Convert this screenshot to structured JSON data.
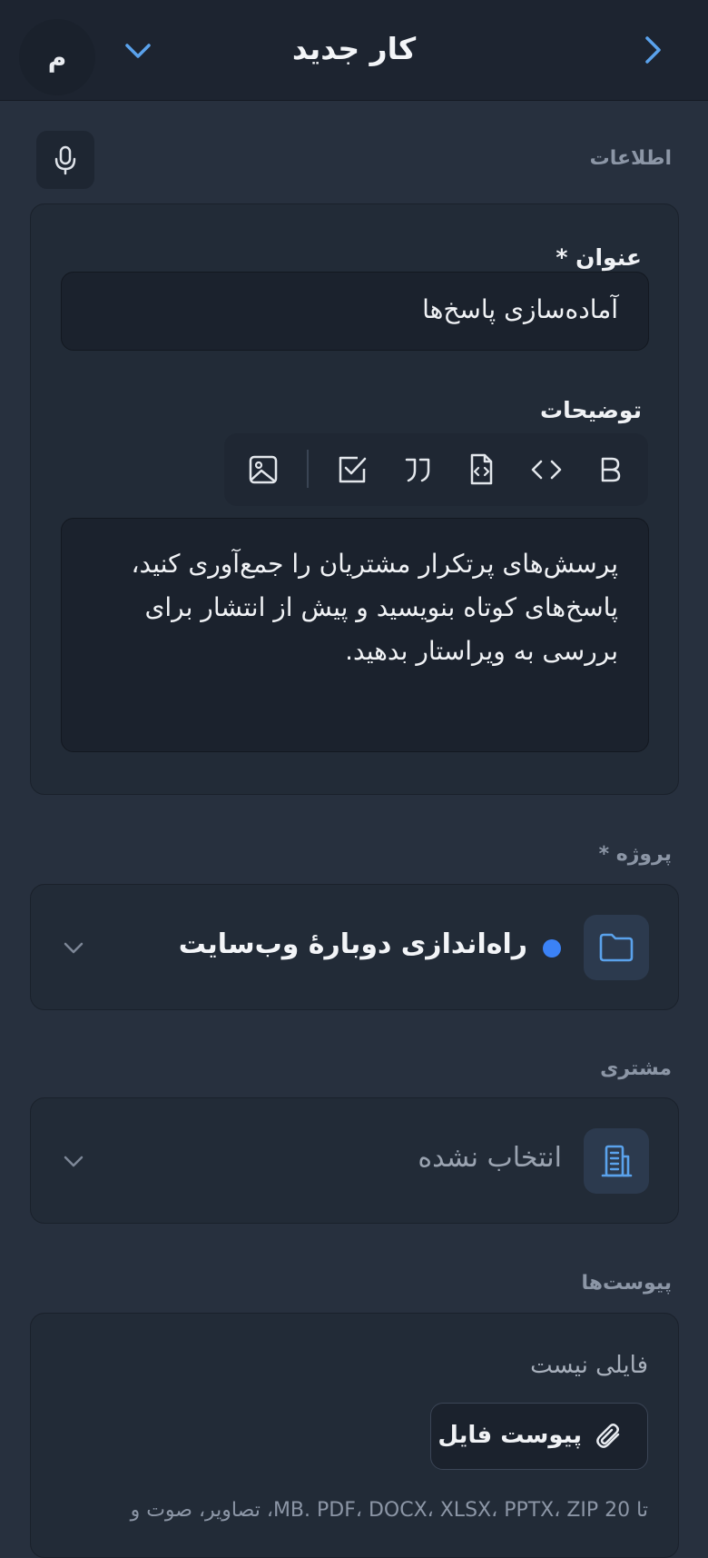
{
  "header": {
    "title": "کار جدید",
    "avatar_initial": "م"
  },
  "info": {
    "section_label": "اطلاعات",
    "title_label": "عنوان *",
    "title_value": "آماده‌سازی پاسخ‌ها",
    "description_label": "توضیحات",
    "toolbar": [
      "bold-icon",
      "code-icon",
      "code-block-icon",
      "quote-icon",
      "checklist-icon",
      "image-icon"
    ],
    "description_value": "پرسش‌های پرتکرار مشتریان را جمع‌آوری کنید، پاسخ‌های کوتاه بنویسید و پیش از انتشار برای بررسی به ویراستار بدهید."
  },
  "project": {
    "label": "پروژه *",
    "selected": "راه‌اندازی دوبارهٔ وب‌سایت",
    "dot_color": "#3b82f6"
  },
  "client": {
    "label": "مشتری",
    "placeholder": "انتخاب نشده"
  },
  "attachments": {
    "label": "پیوست‌ها",
    "empty_text": "فایلی نیست",
    "button_label": "پیوست فایل",
    "hint": "تا 20 MB. PDF، DOCX، XLSX، PPTX، ZIP، تصاویر، صوت و"
  },
  "colors": {
    "accent": "#5aa2ec",
    "background": "#27303e"
  }
}
